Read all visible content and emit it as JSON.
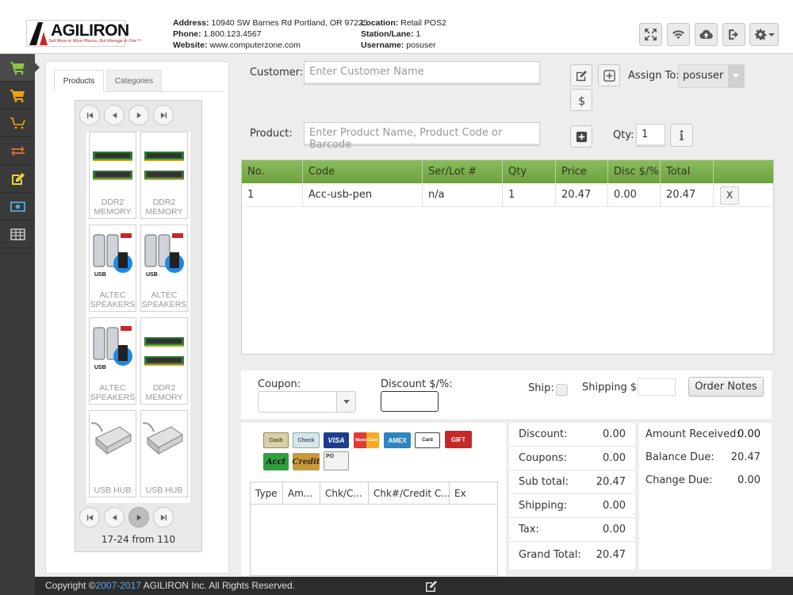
{
  "header": {
    "logo_text": "AGILIRON",
    "logo_tagline": "Sell More in More Places. But Manage in One™",
    "address_label": "Address:",
    "address": "10940 SW Barnes Rd Portland, OR 97225",
    "phone_label": "Phone:",
    "phone": "1.800.123.4567",
    "website_label": "Website:",
    "website": "www.computerzone.com",
    "location_label": "Location:",
    "location": "Retail POS2",
    "station_label": "Station/Lane:",
    "station": "1",
    "username_label": "Username:",
    "username": "posuser",
    "icons": [
      "fullscreen-icon",
      "wifi-icon",
      "cloud-upload-icon",
      "logout-icon",
      "gear-icon"
    ]
  },
  "leftnav": {
    "items": [
      "cart-icon",
      "cart-icon",
      "empty-cart-icon",
      "transfer-icon",
      "edit-icon",
      "cash-icon",
      "table-icon"
    ],
    "colors": [
      "#8bc34a",
      "#f0a30a",
      "#f0a30a",
      "#e0642a",
      "#e6d23a",
      "#5ea3d6",
      "#cccccc"
    ]
  },
  "products": {
    "tabs": [
      "Products",
      "Categories"
    ],
    "items": [
      {
        "label": "DDR2 MEMORY",
        "kind": "ram"
      },
      {
        "label": "DDR2 MEMORY",
        "kind": "ram"
      },
      {
        "label": "ALTEC SPEAKERS",
        "kind": "speaker"
      },
      {
        "label": "ALTEC SPEAKERS",
        "kind": "speaker"
      },
      {
        "label": "ALTEC SPEAKERS",
        "kind": "speaker"
      },
      {
        "label": "DDR2 MEMORY",
        "kind": "ram"
      },
      {
        "label": "USB HUB",
        "kind": "hub"
      },
      {
        "label": "USB HUB",
        "kind": "hub"
      }
    ],
    "page_info": "17-24 from 110"
  },
  "customer": {
    "label": "Customer:",
    "placeholder": "Enter Customer Name",
    "assign_label": "Assign To:",
    "assign_value": "posuser"
  },
  "product": {
    "label": "Product:",
    "placeholder": "Enter Product Name, Product Code or Barcode",
    "qty_label": "Qty:",
    "qty_value": "1"
  },
  "items_table": {
    "headers": [
      "No.",
      "Code",
      "Ser/Lot #",
      "Qty",
      "Price",
      "Disc $/%",
      "Total",
      ""
    ],
    "rows": [
      {
        "no": "1",
        "code": "Acc-usb-pen",
        "serlot": "n/a",
        "qty": "1",
        "price": "20.47",
        "disc": "0.00",
        "total": "20.47",
        "remove": "X"
      }
    ],
    "header_color": "#7aab4d"
  },
  "coupon_bar": {
    "coupon_label": "Coupon:",
    "discount_label": "Discount $/%:",
    "ship_label": "Ship:",
    "shipping_label": "Shipping $:",
    "order_notes": "Order Notes"
  },
  "payments": {
    "methods": [
      "Cash",
      "Check",
      "VISA",
      "MasterCard",
      "AMEX",
      "Card",
      "GIFT",
      "Acct",
      "Credit",
      "PO"
    ],
    "headers": [
      "Type",
      "Am...",
      "Chk/C...",
      "Chk#/Credit C...",
      "Ex"
    ]
  },
  "totals": {
    "rows": [
      {
        "label": "Discount:",
        "value": "0.00"
      },
      {
        "label": "Coupons:",
        "value": "0.00"
      },
      {
        "label": "Sub total:",
        "value": "20.47"
      },
      {
        "label": "Shipping:",
        "value": "0.00"
      },
      {
        "label": "Tax:",
        "value": "0.00"
      },
      {
        "label": "Grand Total:",
        "value": "20.47"
      }
    ]
  },
  "amounts": {
    "rows": [
      {
        "label": "Amount Received:",
        "value": "0.00"
      },
      {
        "label": "Balance Due:",
        "value": "20.47"
      },
      {
        "label": "Change Due:",
        "value": "0.00"
      }
    ]
  },
  "footer": {
    "prefix": "Copyright ©",
    "years": "2007-2017",
    "suffix": " AGILIRON Inc. All Rights Reserved."
  }
}
